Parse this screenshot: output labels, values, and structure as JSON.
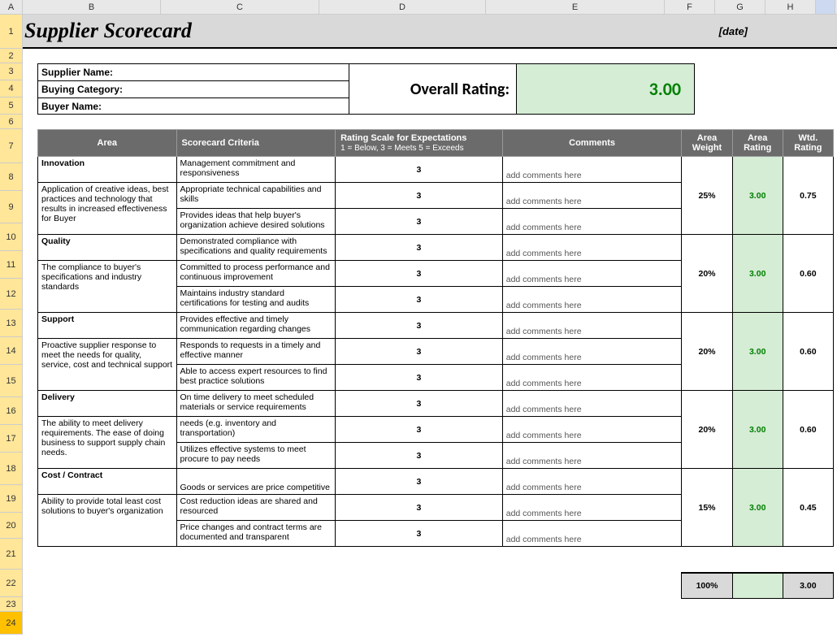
{
  "columns": [
    "A",
    "B",
    "C",
    "D",
    "E",
    "F",
    "G",
    "H"
  ],
  "rows": [
    "1",
    "2",
    "3",
    "4",
    "5",
    "6",
    "7",
    "8",
    "9",
    "10",
    "11",
    "12",
    "13",
    "14",
    "15",
    "16",
    "17",
    "18",
    "19",
    "20",
    "21",
    "22",
    "23",
    "24"
  ],
  "title": "Supplier Scorecard",
  "date_placeholder": "[date]",
  "info": {
    "supplier_label": "Supplier Name:",
    "buying_label": "Buying Category:",
    "buyer_label": "Buyer Name:"
  },
  "overall": {
    "label": "Overall Rating:",
    "value": "3.00"
  },
  "headers": {
    "area": "Area",
    "criteria": "Scorecard Criteria",
    "rating_scale": "Rating Scale for Expectations",
    "rating_scale_sub": "1 = Below, 3 = Meets 5 = Exceeds",
    "comments": "Comments",
    "area_weight": "Area Weight",
    "area_rating": "Area Rating",
    "wtd_rating": "Wtd. Rating"
  },
  "areas": [
    {
      "name": "Innovation",
      "desc": "Application of creative ideas, best practices and technology that results in increased effectiveness for Buyer",
      "weight": "25%",
      "area_rating": "3.00",
      "wtd": "0.75",
      "criteria": [
        {
          "text": "Management commitment and responsiveness",
          "rating": "3",
          "comment": "add comments here"
        },
        {
          "text": "Appropriate technical capabilities and skills",
          "rating": "3",
          "comment": "add comments here"
        },
        {
          "text": "Provides ideas that help buyer's organization achieve desired solutions",
          "rating": "3",
          "comment": "add comments here"
        }
      ]
    },
    {
      "name": "Quality",
      "desc": "The compliance to buyer's specifications and industry standards",
      "weight": "20%",
      "area_rating": "3.00",
      "wtd": "0.60",
      "criteria": [
        {
          "text": "Demonstrated compliance with specifications and quality requirements",
          "rating": "3",
          "comment": "add comments here"
        },
        {
          "text": "Committed to process performance and continuous improvement",
          "rating": "3",
          "comment": "add comments here"
        },
        {
          "text": "Maintains industry standard certifications for testing and audits",
          "rating": "3",
          "comment": "add comments here"
        }
      ]
    },
    {
      "name": "Support",
      "desc": "Proactive supplier response to meet the needs for quality, service, cost and technical support",
      "weight": "20%",
      "area_rating": "3.00",
      "wtd": "0.60",
      "criteria": [
        {
          "text": "Provides effective and timely communication regarding changes",
          "rating": "3",
          "comment": "add comments here"
        },
        {
          "text": "Responds to requests in a timely and effective manner",
          "rating": "3",
          "comment": "add comments here"
        },
        {
          "text": "Able to access expert resources to find best practice solutions",
          "rating": "3",
          "comment": "add comments here"
        }
      ]
    },
    {
      "name": "Delivery",
      "desc": "The ability to meet delivery requirements.  The ease of doing business to support supply chain needs.",
      "weight": "20%",
      "area_rating": "3.00",
      "wtd": "0.60",
      "criteria": [
        {
          "text": "On time delivery to meet scheduled materials or service requirements",
          "rating": "3",
          "comment": "add comments here"
        },
        {
          "text": "needs (e.g. inventory and transportation)",
          "rating": "3",
          "comment": "add comments here"
        },
        {
          "text": "Utilizes effective systems to meet procure to pay needs",
          "rating": "3",
          "comment": "add comments here"
        }
      ]
    },
    {
      "name": "Cost / Contract",
      "desc": "Ability to provide total least cost solutions to buyer's organization",
      "weight": "15%",
      "area_rating": "3.00",
      "wtd": "0.45",
      "criteria": [
        {
          "text": "Goods or services are price competitive",
          "rating": "3",
          "comment": "add comments here"
        },
        {
          "text": "Cost reduction ideas are shared and resourced",
          "rating": "3",
          "comment": "add comments here"
        },
        {
          "text": "Price changes and contract terms are documented and transparent",
          "rating": "3",
          "comment": "add comments here"
        }
      ]
    }
  ],
  "totals": {
    "weight": "100%",
    "wtd": "3.00"
  }
}
